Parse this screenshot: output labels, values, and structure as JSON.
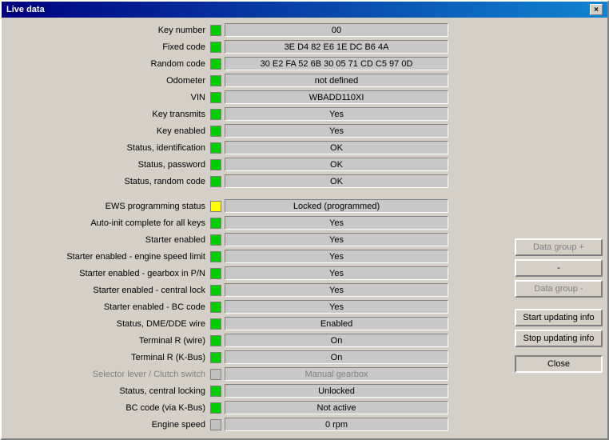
{
  "window": {
    "title": "Live data",
    "close_label": "×"
  },
  "rows": [
    {
      "label": "Key number",
      "indicator": "green",
      "value": "00"
    },
    {
      "label": "Fixed code",
      "indicator": "green",
      "value": "3E D4 82 E6 1E DC B6 4A"
    },
    {
      "label": "Random code",
      "indicator": "green",
      "value": "30 E2 FA 52 6B 30 05 71 CD C5 97 0D"
    },
    {
      "label": "Odometer",
      "indicator": "green",
      "value": "not defined"
    },
    {
      "label": "VIN",
      "indicator": "green",
      "value": "WBADD110XI"
    },
    {
      "label": "Key transmits",
      "indicator": "green",
      "value": "Yes"
    },
    {
      "label": "Key enabled",
      "indicator": "green",
      "value": "Yes"
    },
    {
      "label": "Status, identification",
      "indicator": "green",
      "value": "OK"
    },
    {
      "label": "Status, password",
      "indicator": "green",
      "value": "OK"
    },
    {
      "label": "Status, random code",
      "indicator": "green",
      "value": "OK"
    },
    {
      "separator": true
    },
    {
      "label": "EWS programming status",
      "indicator": "yellow",
      "value": "Locked (programmed)"
    },
    {
      "label": "Auto-init complete for all keys",
      "indicator": "green",
      "value": "Yes"
    },
    {
      "label": "Starter enabled",
      "indicator": "green",
      "value": "Yes"
    },
    {
      "label": "Starter enabled - engine speed limit",
      "indicator": "green",
      "value": "Yes"
    },
    {
      "label": "Starter enabled - gearbox in P/N",
      "indicator": "green",
      "value": "Yes"
    },
    {
      "label": "Starter enabled - central lock",
      "indicator": "green",
      "value": "Yes"
    },
    {
      "label": "Starter enabled - BC code",
      "indicator": "green",
      "value": "Yes"
    },
    {
      "label": "Status, DME/DDE wire",
      "indicator": "green",
      "value": "Enabled"
    },
    {
      "label": "Terminal R (wire)",
      "indicator": "green",
      "value": "On"
    },
    {
      "label": "Terminal R (K-Bus)",
      "indicator": "green",
      "value": "On"
    },
    {
      "label": "Selector lever / Clutch switch",
      "indicator": "gray",
      "value": "Manual gearbox",
      "disabled": true
    },
    {
      "label": "Status, central locking",
      "indicator": "green",
      "value": "Unlocked"
    },
    {
      "label": "BC code (via K-Bus)",
      "indicator": "green",
      "value": "Not active"
    },
    {
      "label": "Engine speed",
      "indicator": "gray",
      "value": "0 rpm"
    }
  ],
  "buttons": {
    "data_group_plus": "Data group +",
    "dash": "-",
    "data_group_minus": "Data group -",
    "start_updating": "Start updating info",
    "stop_updating": "Stop updating info",
    "close": "Close"
  }
}
